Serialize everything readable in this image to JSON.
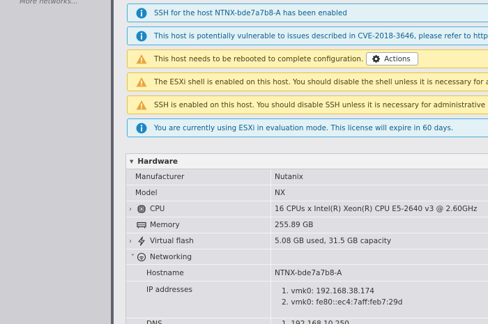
{
  "sidebar": {
    "more_networks": "More networks..."
  },
  "alerts": [
    {
      "type": "info",
      "text": "SSH for the host NTNX-bde7a7b8-A has been enabled"
    },
    {
      "type": "info",
      "text": "This host is potentially vulnerable to issues described in CVE-2018-3646, please refer to https://kb"
    },
    {
      "type": "warn",
      "text": "This host needs to be rebooted to complete configuration.",
      "button": "Actions"
    },
    {
      "type": "warn",
      "text": "The ESXi shell is enabled on this host. You should disable the shell unless it is necessary for admini"
    },
    {
      "type": "warn",
      "text": "SSH is enabled on this host. You should disable SSH unless it is necessary for administrative purpo"
    },
    {
      "type": "info",
      "text": "You are currently using ESXi in evaluation mode. This license will expire in 60 days."
    }
  ],
  "hardware": {
    "title": "Hardware",
    "rows": {
      "manufacturer": {
        "label": "Manufacturer",
        "value": "Nutanix"
      },
      "model": {
        "label": "Model",
        "value": "NX"
      },
      "cpu": {
        "label": "CPU",
        "value": "16 CPUs x Intel(R) Xeon(R) CPU E5-2640 v3 @ 2.60GHz",
        "icon": "cpu-icon"
      },
      "memory": {
        "label": "Memory",
        "value": "255.89 GB",
        "icon": "memory-icon"
      },
      "virtual_flash": {
        "label": "Virtual flash",
        "value": "5.08 GB used, 31.5 GB capacity",
        "icon": "flash-icon"
      },
      "networking": {
        "label": "Networking",
        "value": "",
        "icon": "network-icon"
      },
      "hostname": {
        "label": "Hostname",
        "value": "NTNX-bde7a7b8-A"
      },
      "ip_addresses": {
        "label": "IP addresses",
        "values": [
          "1. vmk0: 192.168.38.174",
          "2. vmk0: fe80::ec4:7aff:feb7:29d"
        ]
      },
      "dns": {
        "label": "DNS",
        "value": "1. 192.168.10.250"
      }
    }
  },
  "colors": {
    "info_icon": "#1d86c4",
    "warn_icon": "#e9a53a",
    "sidebar": "#cfcfd3"
  }
}
